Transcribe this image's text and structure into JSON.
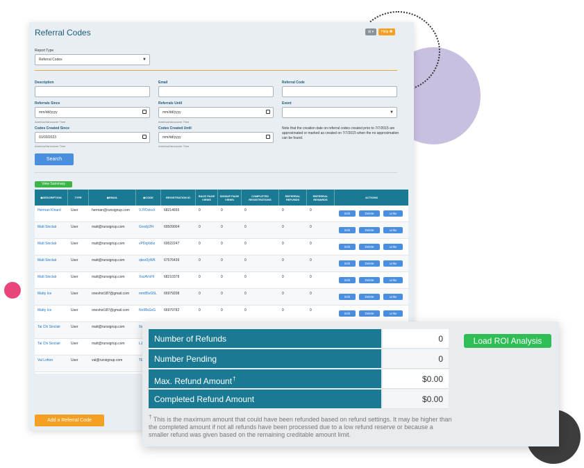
{
  "panel": {
    "title": "Referral Codes",
    "header_buttons": {
      "export_label": "⊞ ▾",
      "help_label": "Help ❶"
    },
    "report_type": {
      "label": "Report Type",
      "value": "Referral Codes"
    },
    "filters": {
      "description_label": "Description",
      "email_label": "Email",
      "referral_code_label": "Referral Code",
      "referrals_since_label": "Referrals Since",
      "referrals_since_value": "mm/dd/yyyy",
      "referrals_until_label": "Referrals Until",
      "referrals_until_value": "mm/dd/yyyy",
      "event_label": "Event",
      "timezone_hint": "America/Vancouver Time",
      "codes_created_since_label": "Codes Created Since",
      "codes_created_since_value": "01/03/2023",
      "codes_created_until_label": "Codes Created Until",
      "codes_created_until_value": "mm/dd/yyyy",
      "note": "Note that the creation date on referral codes created prior to 7/7/2015 are approximated or marked as created on 7/7/2015 when the no approximation can be found."
    },
    "search_label": "Search",
    "view_summary_label": "View Summary",
    "add_code_label": "Add a Referral Code",
    "table": {
      "headers": {
        "description": "DESCRIPTION",
        "type": "TYPE",
        "email": "EMAIL",
        "code": "CODE",
        "registration_id": "REGISTRATION ID",
        "race_page_views": "RACE PAGE VIEWS",
        "signup_page_views": "SIGNUP PAGE VIEWS",
        "completed_registrations": "COMPLETED REGISTRATIONS",
        "referral_refunds": "REFERRAL REFUNDS",
        "referral_rewards": "REFERRAL REWARDS",
        "actions": "ACTIONS"
      },
      "action_labels": {
        "edit": "Edit",
        "delete": "Delete",
        "links": "Links"
      },
      "rows": [
        {
          "description": "Herman Kinard",
          "type": "User",
          "email": "herman@runsignup.com",
          "code": "VJYDckvX",
          "registration_id": "68214655",
          "race_views": "0",
          "signup_views": "0",
          "completed": "0",
          "refunds": "0",
          "rewards": "0"
        },
        {
          "description": "Matt Sinclair",
          "type": "User",
          "email": "matt@runsignup.com",
          "code": "Gvxdy2Ft",
          "registration_id": "69509004",
          "race_views": "0",
          "signup_views": "0",
          "completed": "0",
          "refunds": "0",
          "rewards": "0"
        },
        {
          "description": "Matt Sinclair",
          "type": "User",
          "email": "matt@runsignup.com",
          "code": "vPDqXkbz",
          "registration_id": "69522247",
          "race_views": "0",
          "signup_views": "0",
          "completed": "0",
          "refunds": "0",
          "rewards": "0"
        },
        {
          "description": "Matt Sinclair",
          "type": "User",
          "email": "matt@runsignup.com",
          "code": "qkez0yWK",
          "registration_id": "67576439",
          "race_views": "0",
          "signup_views": "0",
          "completed": "0",
          "refunds": "0",
          "rewards": "0"
        },
        {
          "description": "Matt Sinclair",
          "type": "User",
          "email": "matt@runsignup.com",
          "code": "XxzAVxHI",
          "registration_id": "68210378",
          "race_views": "0",
          "signup_views": "0",
          "completed": "0",
          "refunds": "0",
          "rewards": "0"
        },
        {
          "description": "Matty Ice",
          "type": "User",
          "email": "oneshot187@gmail.com",
          "code": "mm85vG5L",
          "registration_id": "66979208",
          "race_views": "0",
          "signup_views": "0",
          "completed": "0",
          "refunds": "0",
          "rewards": "0"
        },
        {
          "description": "Matty Ice",
          "type": "User",
          "email": "oneshot187@gmail.com",
          "code": "NnIRkGxG",
          "registration_id": "66979782",
          "race_views": "0",
          "signup_views": "0",
          "completed": "0",
          "refunds": "0",
          "rewards": "0"
        },
        {
          "description": "Tai Chi Sinclair",
          "type": "User",
          "email": "matt@runsignup.com",
          "code": "9o"
        },
        {
          "description": "Tai Chi Sinclair",
          "type": "User",
          "email": "matt@runsignup.com",
          "code": "LJ"
        },
        {
          "description": "Val Lofton",
          "type": "User",
          "email": "val@runsignup.com",
          "code": "TE"
        }
      ]
    }
  },
  "refunds_card": {
    "rows": [
      {
        "label": "Number of Refunds",
        "value": "0"
      },
      {
        "label": "Number Pending",
        "value": "0"
      },
      {
        "label": "Max. Refund Amount",
        "value": "$0.00"
      },
      {
        "label": "Completed Refund Amount",
        "value": "$0.00"
      }
    ],
    "dagger": "†",
    "roi_button_label": "Load ROI Analysis",
    "footnote": "This is the maximum amount that could have been refunded based on refund settings. It may be higher than the completed amount if not all refunds have been processed due to a low refund reserve or because a smaller refund was given based on the remaining creditable amount limit."
  }
}
